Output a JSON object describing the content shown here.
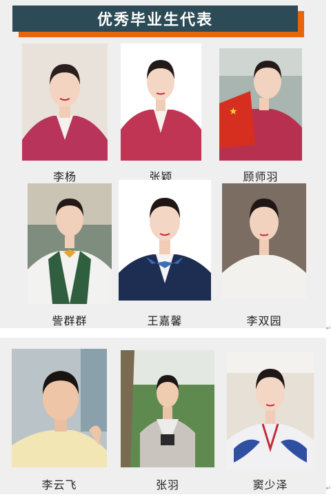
{
  "header": {
    "title": "优秀毕业生代表"
  },
  "top_grid": [
    {
      "name": "李杨"
    },
    {
      "name": "张颖"
    },
    {
      "name": "顾师羽"
    },
    {
      "name": "訾群群"
    },
    {
      "name": "王嘉馨"
    },
    {
      "name": "李双园"
    }
  ],
  "bottom_grid": [
    {
      "name": "李云飞"
    },
    {
      "name": "张羽"
    },
    {
      "name": "窦少泽"
    }
  ],
  "colors": {
    "banner": "#2c4b56",
    "banner_shadow": "#e8650f",
    "panel": "#efefef"
  }
}
